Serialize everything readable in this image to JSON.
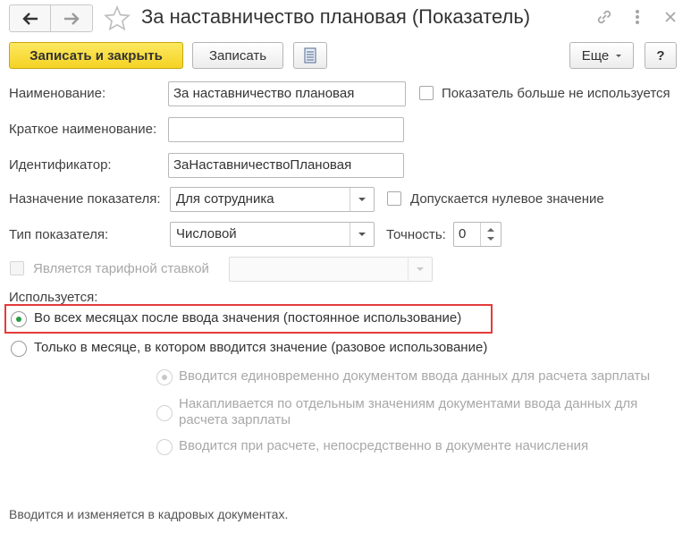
{
  "window": {
    "title": "За наставничество плановая (Показатель)",
    "icons": [
      "back-arrow-icon",
      "forward-arrow-icon",
      "star-icon",
      "link-icon",
      "more-icon",
      "close-icon"
    ]
  },
  "toolbar": {
    "save_close_label": "Записать и закрыть",
    "save_label": "Записать",
    "more_label": "Еще",
    "help_label": "?"
  },
  "form": {
    "name_label": "Наименование:",
    "name_value": "За наставничество плановая",
    "not_used_label": "Показатель больше не используется",
    "short_name_label": "Краткое наименование:",
    "short_name_value": "",
    "id_label": "Идентификатор:",
    "id_value": "ЗаНаставничествоПлановая",
    "purpose_label": "Назначение показателя:",
    "purpose_value": "Для сотрудника",
    "zero_allowed_label": "Допускается нулевое значение",
    "type_label": "Тип показателя:",
    "type_value": "Числовой",
    "precision_label": "Точность:",
    "precision_value": "0",
    "tariff_label": "Является тарифной ставкой",
    "tariff_value": ""
  },
  "usage": {
    "section_label": "Используется:",
    "option_all_months": "Во всех месяцах после ввода значения (постоянное использование)",
    "option_one_month": "Только в месяце, в котором вводится значение (разовое использование)",
    "sub_option_1": "Вводится единовременно документом ввода данных для расчета зарплаты",
    "sub_option_2_line1": "Накапливается по отдельным значениям документами ввода данных для",
    "sub_option_2_line2": "расчета зарплаты",
    "sub_option_3": "Вводится при расчете, непосредственно в документе начисления",
    "selected": "option_all_months"
  },
  "footer": {
    "note": "Вводится и изменяется в кадровых документах."
  },
  "colors": {
    "primary_button": "#f4d324",
    "radio_checked": "#2a9d44",
    "highlight_border": "#e33b3b"
  }
}
